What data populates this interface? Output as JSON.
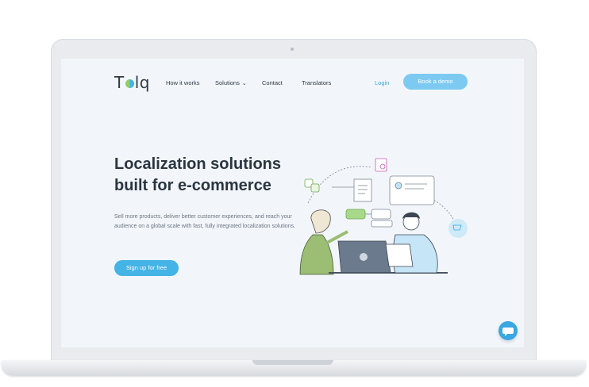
{
  "brand": {
    "logo_prefix": "T",
    "logo_suffix": "lq"
  },
  "nav": {
    "items": [
      {
        "label": "How it works"
      },
      {
        "label": "Solutions"
      },
      {
        "label": "Contact"
      },
      {
        "label": "Translators"
      }
    ],
    "login": "Login",
    "demo": "Book a demo"
  },
  "hero": {
    "title_line1": "Localization solutions",
    "title_line2": "built for e-commerce",
    "subtitle": "Sell more products, deliver better customer experiences, and reach your audience on a global scale with fast, fully integrated localization solutions.",
    "cta": "Sign up for free"
  },
  "colors": {
    "accent": "#44b3e6",
    "accent_light": "#7ccaf2",
    "text_dark": "#2a3540",
    "green": "#8fcf6a"
  },
  "icons": {
    "chat": "chat-bubble-icon",
    "dropdown": "chevron-down-icon"
  }
}
